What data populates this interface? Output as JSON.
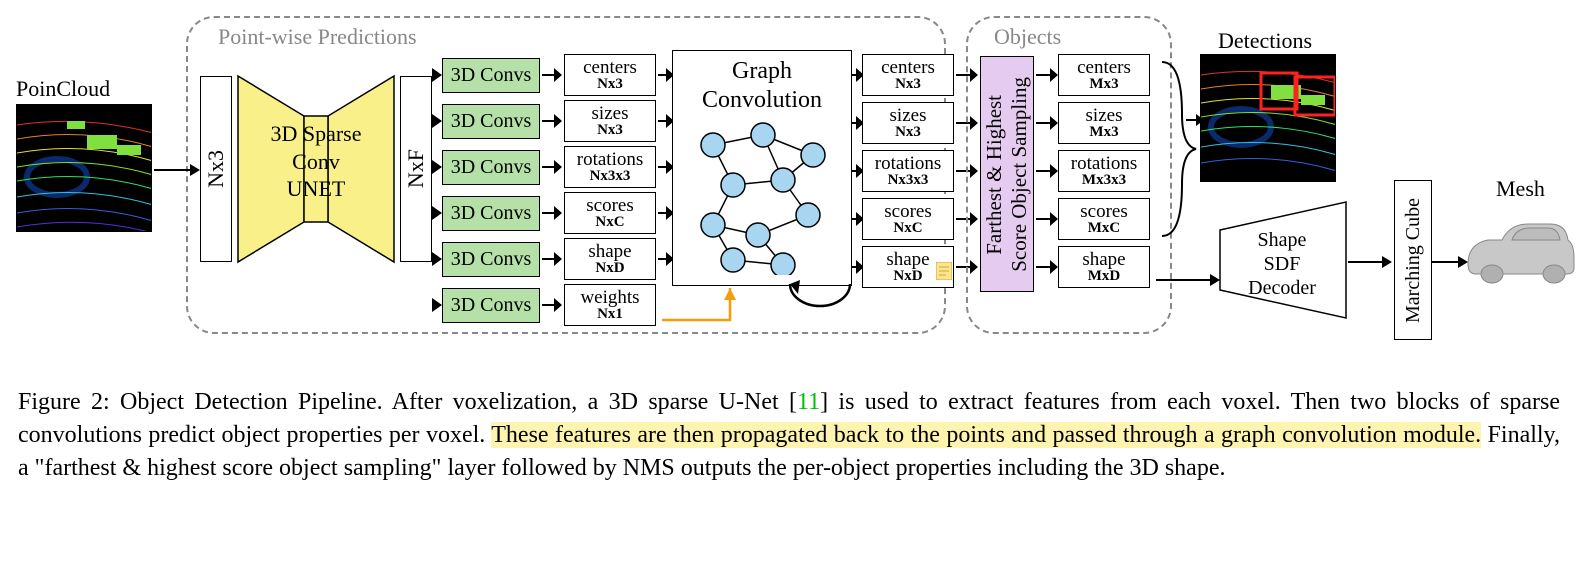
{
  "input_label": "PoinCloud",
  "pointwise_title": "Point-wise Predictions",
  "objects_title": "Objects",
  "nx3": "Nx3",
  "nxf": "NxF",
  "unet": "3D Sparse\nConv\nUNET",
  "conv_label": "3D Convs",
  "preds1": [
    {
      "name": "centers",
      "dim": "Nx3"
    },
    {
      "name": "sizes",
      "dim": "Nx3"
    },
    {
      "name": "rotations",
      "dim": "Nx3x3"
    },
    {
      "name": "scores",
      "dim": "NxC"
    },
    {
      "name": "shape",
      "dim": "NxD"
    },
    {
      "name": "weights",
      "dim": "Nx1"
    }
  ],
  "graphconv": "Graph\nConvolution",
  "preds2": [
    {
      "name": "centers",
      "dim": "Nx3"
    },
    {
      "name": "sizes",
      "dim": "Nx3"
    },
    {
      "name": "rotations",
      "dim": "Nx3x3"
    },
    {
      "name": "scores",
      "dim": "NxC"
    },
    {
      "name": "shape",
      "dim": "NxD"
    }
  ],
  "sampler": "Farthest & Highest\nScore Object Sampling",
  "preds3": [
    {
      "name": "centers",
      "dim": "Mx3"
    },
    {
      "name": "sizes",
      "dim": "Mx3"
    },
    {
      "name": "rotations",
      "dim": "Mx3x3"
    },
    {
      "name": "scores",
      "dim": "MxC"
    },
    {
      "name": "shape",
      "dim": "MxD"
    }
  ],
  "detections_label": "Detections",
  "decoder": "Shape\nSDF\nDecoder",
  "marching": "Marching Cube",
  "mesh_label": "Mesh",
  "caption": {
    "head": "Figure 2: Object Detection Pipeline.  After voxelization, a 3D sparse U-Net [",
    "ref": "11",
    "mid1": "] is used to extract features from each voxel. Then two blocks of sparse convolutions predict object properties per voxel.  ",
    "hl": "These features are then propagated back to the points and passed through a graph convolution module.",
    "tail": "  Finally, a \"farthest & highest score object sampling\" layer followed by NMS outputs the per-object properties including the 3D shape."
  }
}
